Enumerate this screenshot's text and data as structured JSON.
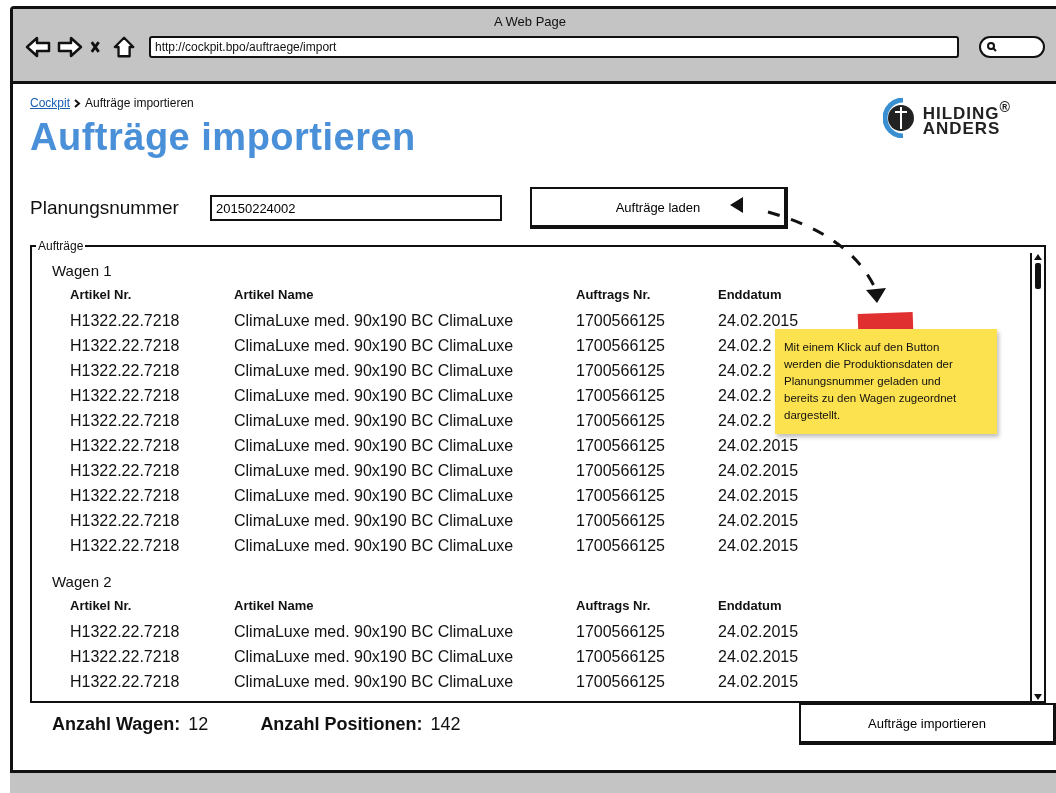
{
  "window": {
    "title": "A Web Page",
    "url": "http://cockpit.bpo/auftraege/import"
  },
  "breadcrumb": [
    {
      "label": "Cockpit",
      "kind": "link"
    },
    {
      "label": "Aufträge importieren",
      "kind": "current"
    }
  ],
  "heading": "Aufträge importieren",
  "logo": {
    "line1": "HILDING$^{®}$",
    "line2": "ANDERS"
  },
  "planning": {
    "label": "Planungsnummer",
    "value": "20150224002"
  },
  "load_button": "Aufträge laden",
  "orders": {
    "legend": "Aufträge",
    "groups": [
      {
        "title": "Wagen 1",
        "columns": [
          "Artikel Nr.",
          "Artikel Name",
          "Auftrags Nr.",
          "Enddatum"
        ],
        "rows": [
          [
            "H1322.22.7218",
            "ClimaLuxe med. 90x190 BC ClimaLuxe",
            "1700566125",
            "24.02.2015"
          ],
          [
            "H1322.22.7218",
            "ClimaLuxe med. 90x190 BC ClimaLuxe",
            "1700566125",
            "24.02.2"
          ],
          [
            "H1322.22.7218",
            "ClimaLuxe med. 90x190 BC ClimaLuxe",
            "1700566125",
            "24.02.2"
          ],
          [
            "H1322.22.7218",
            "ClimaLuxe med. 90x190 BC ClimaLuxe",
            "1700566125",
            "24.02.2"
          ],
          [
            "H1322.22.7218",
            "ClimaLuxe med. 90x190 BC ClimaLuxe",
            "1700566125",
            "24.02.2"
          ],
          [
            "H1322.22.7218",
            "ClimaLuxe med. 90x190 BC ClimaLuxe",
            "1700566125",
            "24.02.2015"
          ],
          [
            "H1322.22.7218",
            "ClimaLuxe med. 90x190 BC ClimaLuxe",
            "1700566125",
            "24.02.2015"
          ],
          [
            "H1322.22.7218",
            "ClimaLuxe med. 90x190 BC ClimaLuxe",
            "1700566125",
            "24.02.2015"
          ],
          [
            "H1322.22.7218",
            "ClimaLuxe med. 90x190 BC ClimaLuxe",
            "1700566125",
            "24.02.2015"
          ],
          [
            "H1322.22.7218",
            "ClimaLuxe med. 90x190 BC ClimaLuxe",
            "1700566125",
            "24.02.2015"
          ]
        ]
      },
      {
        "title": "Wagen 2",
        "columns": [
          "Artikel Nr.",
          "Artikel Name",
          "Auftrags Nr.",
          "Enddatum"
        ],
        "rows": [
          [
            "H1322.22.7218",
            "ClimaLuxe med. 90x190 BC ClimaLuxe",
            "1700566125",
            "24.02.2015"
          ],
          [
            "H1322.22.7218",
            "ClimaLuxe med. 90x190 BC ClimaLuxe",
            "1700566125",
            "24.02.2015"
          ],
          [
            "H1322.22.7218",
            "ClimaLuxe med. 90x190 BC ClimaLuxe",
            "1700566125",
            "24.02.2015"
          ]
        ]
      }
    ]
  },
  "summary": [
    {
      "label": "Anzahl Wagen:",
      "value": "12"
    },
    {
      "label": "Anzahl Positionen:",
      "value": "142"
    }
  ],
  "import_button": "Aufträge importieren",
  "note": {
    "text": "Mit einem Klick auf den Button werden die Produktionsdaten der Planungsnummer geladen und bereits zu den Wagen zugeordnet dargestellt."
  }
}
